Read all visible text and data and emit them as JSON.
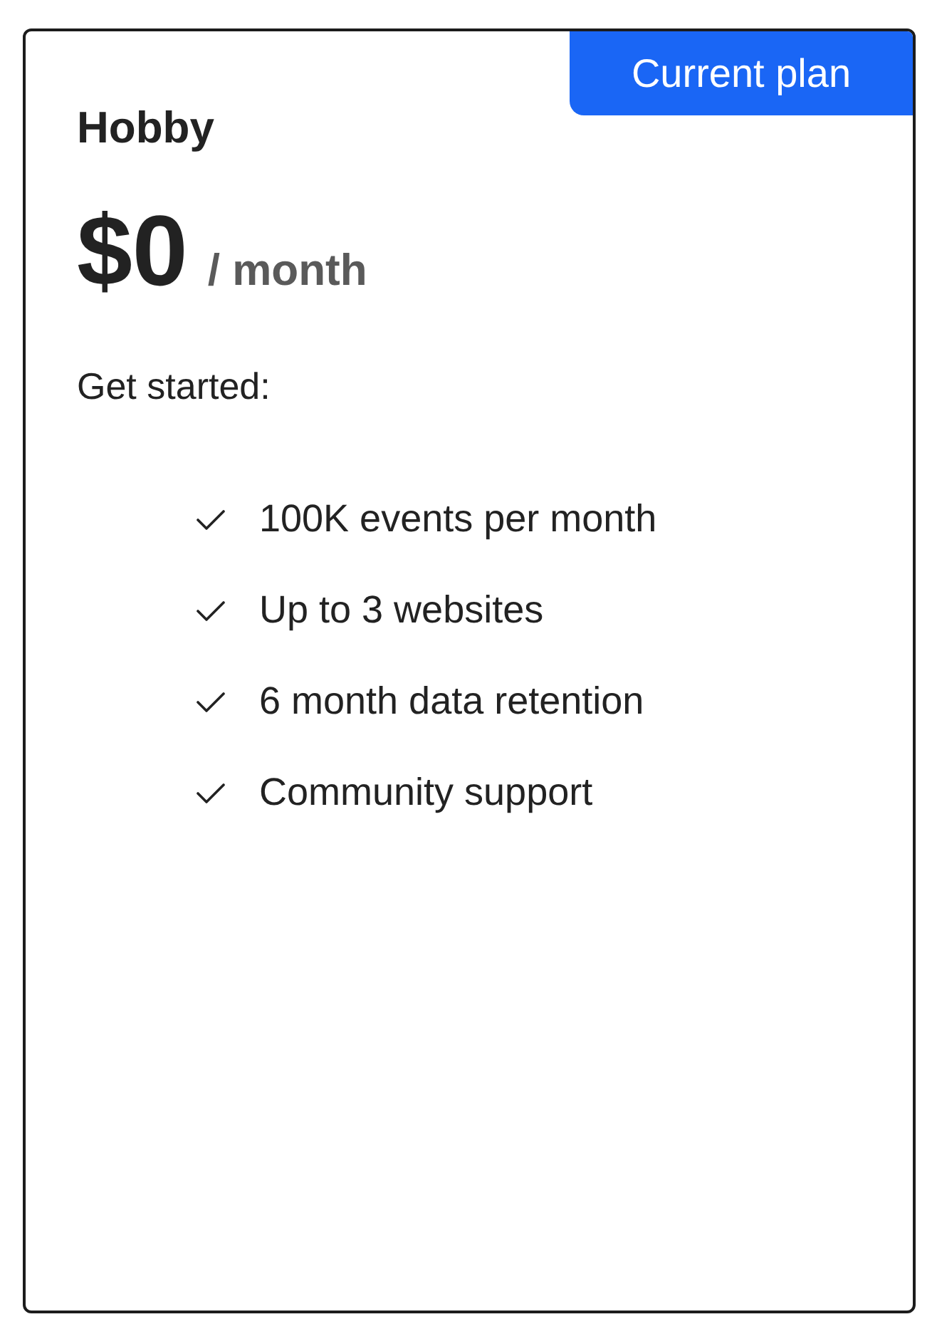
{
  "card": {
    "badge": "Current plan",
    "plan_name": "Hobby",
    "price": "$0",
    "period": "/ month",
    "intro": "Get started:",
    "features": [
      {
        "label": "100K events per month"
      },
      {
        "label": "Up to 3 websites"
      },
      {
        "label": "6 month data retention"
      },
      {
        "label": "Community support"
      }
    ]
  }
}
